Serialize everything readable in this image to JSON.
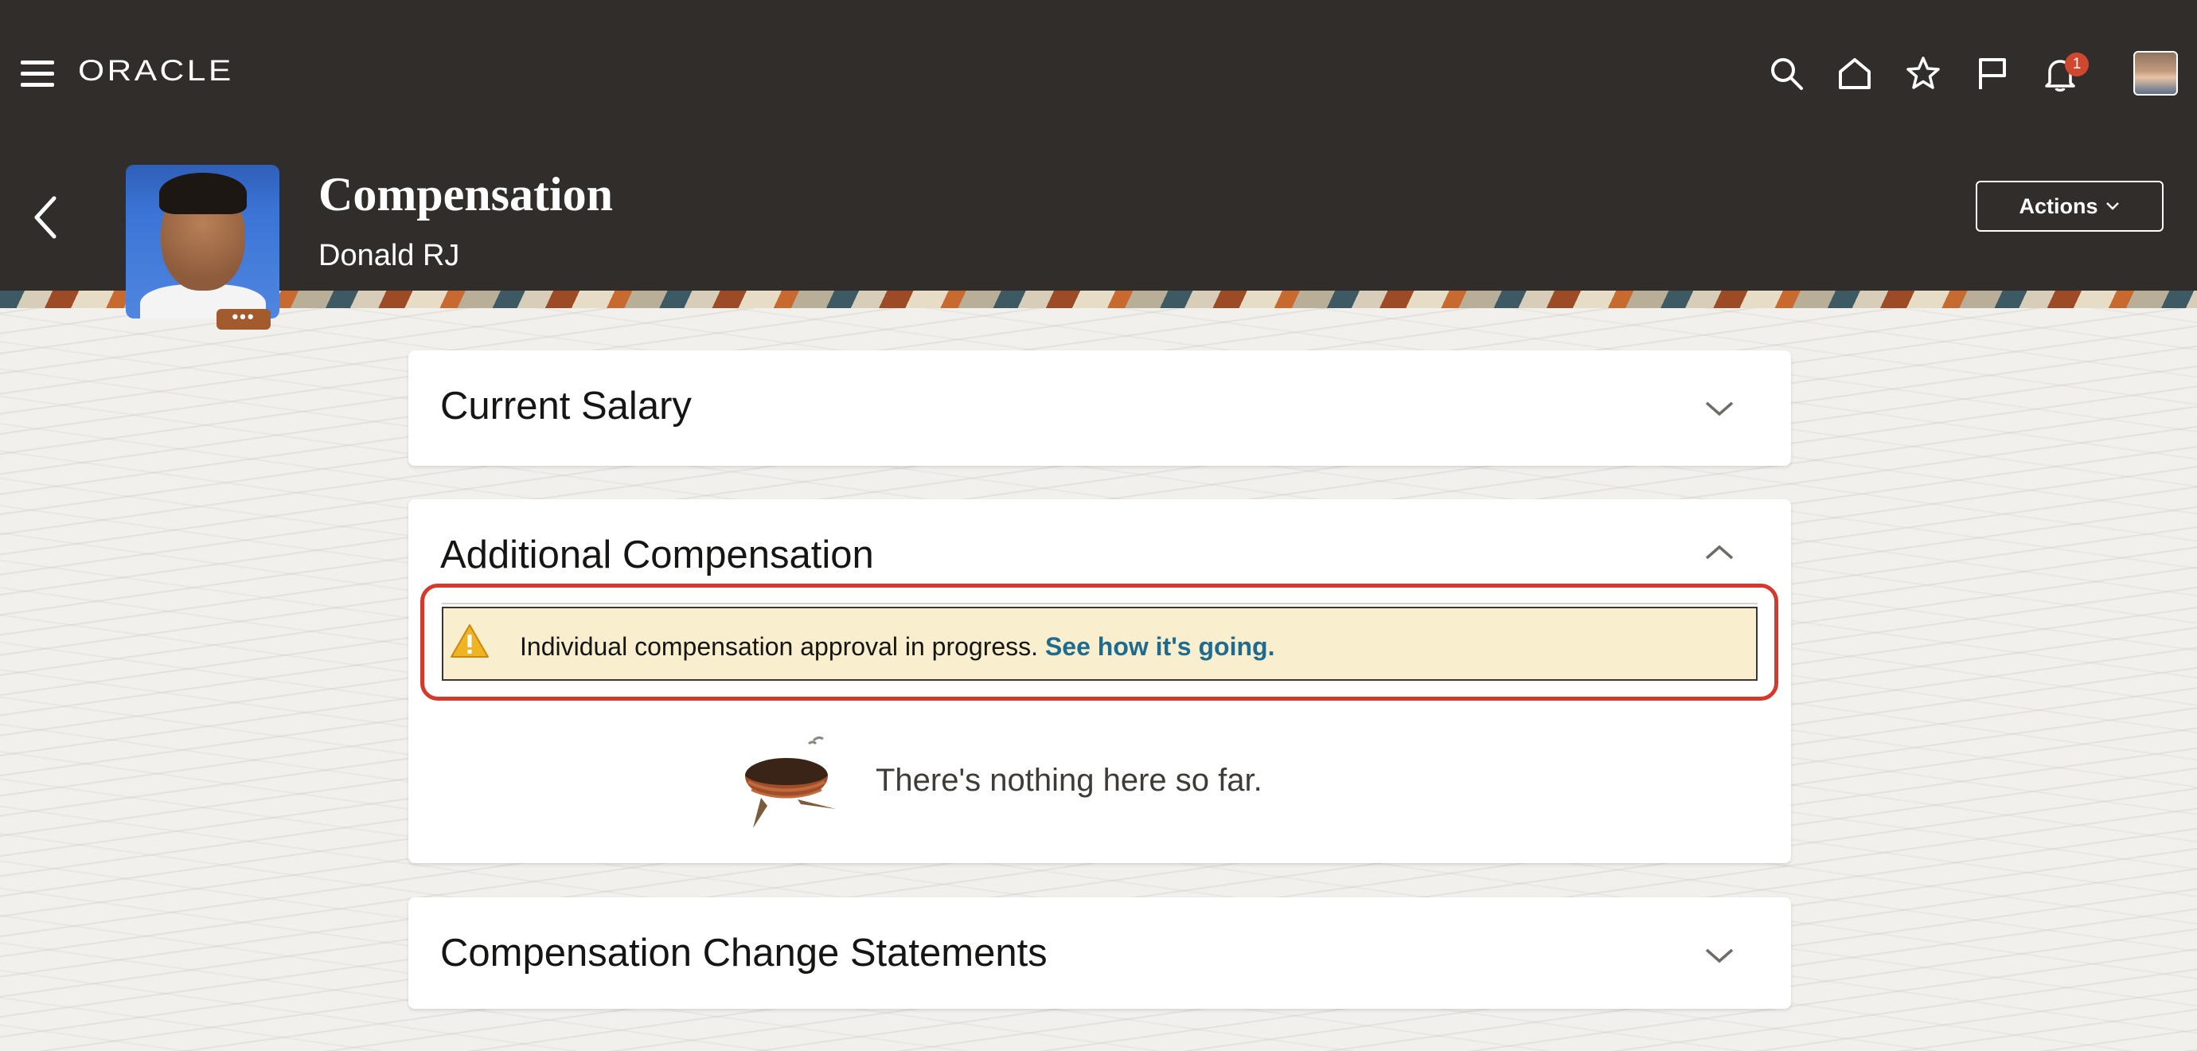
{
  "header": {
    "logo": "ORACLE",
    "notification_count": "1",
    "icons": [
      "menu-icon",
      "search-icon",
      "home-icon",
      "star-icon",
      "flag-icon",
      "bell-icon"
    ]
  },
  "page": {
    "title": "Compensation",
    "subtitle": "Donald RJ",
    "photo_more": "•••",
    "actions_label": "Actions"
  },
  "sections": {
    "current_salary": {
      "title": "Current Salary",
      "state": "collapsed"
    },
    "additional_compensation": {
      "title": "Additional Compensation",
      "state": "expanded",
      "alert_text": "Individual compensation approval in progress.",
      "alert_link": "See how it's going.",
      "empty_text": "There's nothing here so far."
    },
    "change_statements": {
      "title": "Compensation Change Statements",
      "state": "collapsed"
    }
  },
  "colors": {
    "header_bg": "#312d2a",
    "alert_bg": "#f9efcf",
    "link": "#1f6a8f",
    "highlight": "#d5392b",
    "badge": "#d0472f"
  }
}
